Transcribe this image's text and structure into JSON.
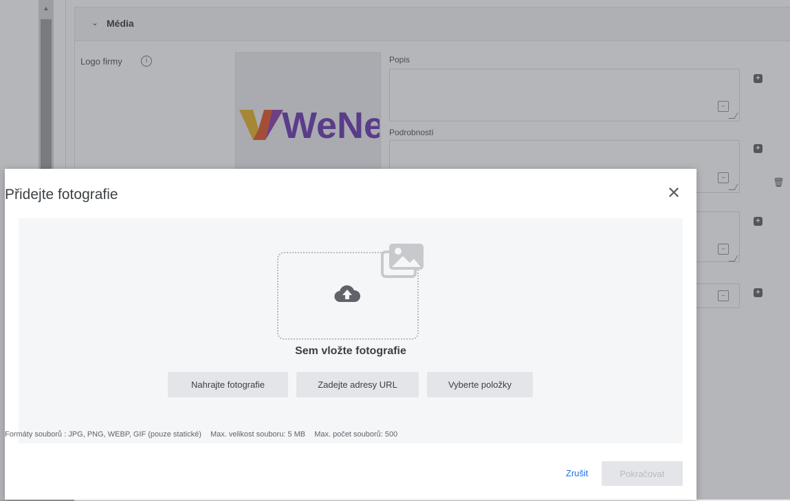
{
  "background": {
    "section_title": "Média",
    "logo_label": "Logo firmy",
    "logo_text": "WeNet",
    "fields": [
      {
        "label": "Popis"
      },
      {
        "label": "Podrobností"
      }
    ]
  },
  "modal": {
    "title": "Přidejte fotografie",
    "drop_label": "Sem vložte fotografie",
    "buttons": {
      "upload": "Nahrajte fotografie",
      "url": "Zadejte adresy URL",
      "select": "Vyberte položky"
    },
    "info": {
      "formats": "Formáty souborů : JPG, PNG, WEBP, GIF (pouze statické)",
      "max_size": "Max. velikost souboru: 5 MB",
      "max_count": "Max. počet souborů: 500"
    },
    "footer": {
      "cancel": "Zrušit",
      "continue": "Pokračovat"
    }
  },
  "colors": {
    "accent": "#1a73e8",
    "overlay": "#3c4046",
    "drop_area": "#f5f6f7",
    "button": "#e3e5e8"
  }
}
